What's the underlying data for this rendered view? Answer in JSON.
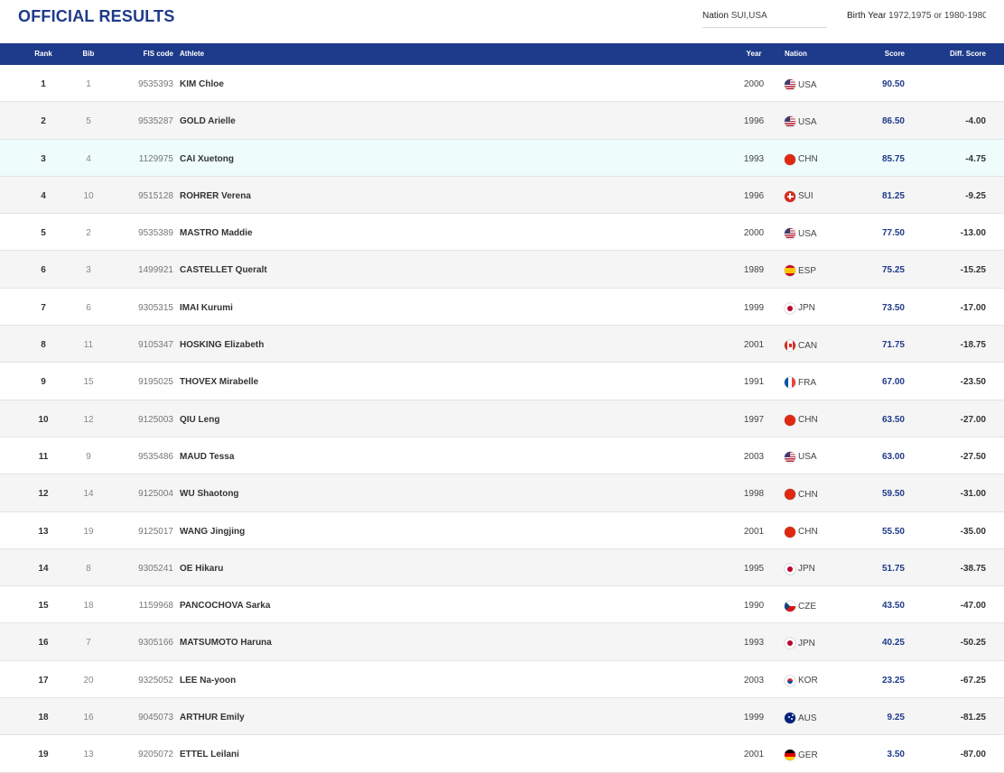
{
  "page": {
    "title": "OFFICIAL RESULTS",
    "filters": {
      "nation_label": "Nation",
      "nation_value": "SUI,USA",
      "birth_label": "Birth Year",
      "birth_value": "1972,1975 or 1980-1980"
    }
  },
  "colors": {
    "header_bg": "#1e3a8a",
    "title": "#1e3a8a",
    "score": "#1e3a8a",
    "highlight_row": "#eefcfc"
  },
  "table": {
    "columns": {
      "rank": "Rank",
      "bib": "Bib",
      "fis": "FIS code",
      "athlete": "Athlete",
      "year": "Year",
      "nation": "Nation",
      "score": "Score",
      "diff": "Diff. Score"
    },
    "rows": [
      {
        "rank": "1",
        "bib": "1",
        "fis": "9535393",
        "athlete": "KIM Chloe",
        "year": "2000",
        "nation": "USA",
        "score": "90.50",
        "diff": ""
      },
      {
        "rank": "2",
        "bib": "5",
        "fis": "9535287",
        "athlete": "GOLD Arielle",
        "year": "1996",
        "nation": "USA",
        "score": "86.50",
        "diff": "-4.00"
      },
      {
        "rank": "3",
        "bib": "4",
        "fis": "1129975",
        "athlete": "CAI Xuetong",
        "year": "1993",
        "nation": "CHN",
        "score": "85.75",
        "diff": "-4.75"
      },
      {
        "rank": "4",
        "bib": "10",
        "fis": "9515128",
        "athlete": "ROHRER Verena",
        "year": "1996",
        "nation": "SUI",
        "score": "81.25",
        "diff": "-9.25"
      },
      {
        "rank": "5",
        "bib": "2",
        "fis": "9535389",
        "athlete": "MASTRO Maddie",
        "year": "2000",
        "nation": "USA",
        "score": "77.50",
        "diff": "-13.00"
      },
      {
        "rank": "6",
        "bib": "3",
        "fis": "1499921",
        "athlete": "CASTELLET Queralt",
        "year": "1989",
        "nation": "ESP",
        "score": "75.25",
        "diff": "-15.25"
      },
      {
        "rank": "7",
        "bib": "6",
        "fis": "9305315",
        "athlete": "IMAI Kurumi",
        "year": "1999",
        "nation": "JPN",
        "score": "73.50",
        "diff": "-17.00"
      },
      {
        "rank": "8",
        "bib": "11",
        "fis": "9105347",
        "athlete": "HOSKING Elizabeth",
        "year": "2001",
        "nation": "CAN",
        "score": "71.75",
        "diff": "-18.75"
      },
      {
        "rank": "9",
        "bib": "15",
        "fis": "9195025",
        "athlete": "THOVEX Mirabelle",
        "year": "1991",
        "nation": "FRA",
        "score": "67.00",
        "diff": "-23.50"
      },
      {
        "rank": "10",
        "bib": "12",
        "fis": "9125003",
        "athlete": "QIU Leng",
        "year": "1997",
        "nation": "CHN",
        "score": "63.50",
        "diff": "-27.00"
      },
      {
        "rank": "11",
        "bib": "9",
        "fis": "9535486",
        "athlete": "MAUD Tessa",
        "year": "2003",
        "nation": "USA",
        "score": "63.00",
        "diff": "-27.50"
      },
      {
        "rank": "12",
        "bib": "14",
        "fis": "9125004",
        "athlete": "WU Shaotong",
        "year": "1998",
        "nation": "CHN",
        "score": "59.50",
        "diff": "-31.00"
      },
      {
        "rank": "13",
        "bib": "19",
        "fis": "9125017",
        "athlete": "WANG Jingjing",
        "year": "2001",
        "nation": "CHN",
        "score": "55.50",
        "diff": "-35.00"
      },
      {
        "rank": "14",
        "bib": "8",
        "fis": "9305241",
        "athlete": "OE Hikaru",
        "year": "1995",
        "nation": "JPN",
        "score": "51.75",
        "diff": "-38.75"
      },
      {
        "rank": "15",
        "bib": "18",
        "fis": "1159968",
        "athlete": "PANCOCHOVA Sarka",
        "year": "1990",
        "nation": "CZE",
        "score": "43.50",
        "diff": "-47.00"
      },
      {
        "rank": "16",
        "bib": "7",
        "fis": "9305166",
        "athlete": "MATSUMOTO Haruna",
        "year": "1993",
        "nation": "JPN",
        "score": "40.25",
        "diff": "-50.25"
      },
      {
        "rank": "17",
        "bib": "20",
        "fis": "9325052",
        "athlete": "LEE Na-yoon",
        "year": "2003",
        "nation": "KOR",
        "score": "23.25",
        "diff": "-67.25"
      },
      {
        "rank": "18",
        "bib": "16",
        "fis": "9045073",
        "athlete": "ARTHUR Emily",
        "year": "1999",
        "nation": "AUS",
        "score": "9.25",
        "diff": "-81.25"
      },
      {
        "rank": "19",
        "bib": "13",
        "fis": "9205072",
        "athlete": "ETTEL Leilani",
        "year": "2001",
        "nation": "GER",
        "score": "3.50",
        "diff": "-87.00"
      }
    ]
  }
}
